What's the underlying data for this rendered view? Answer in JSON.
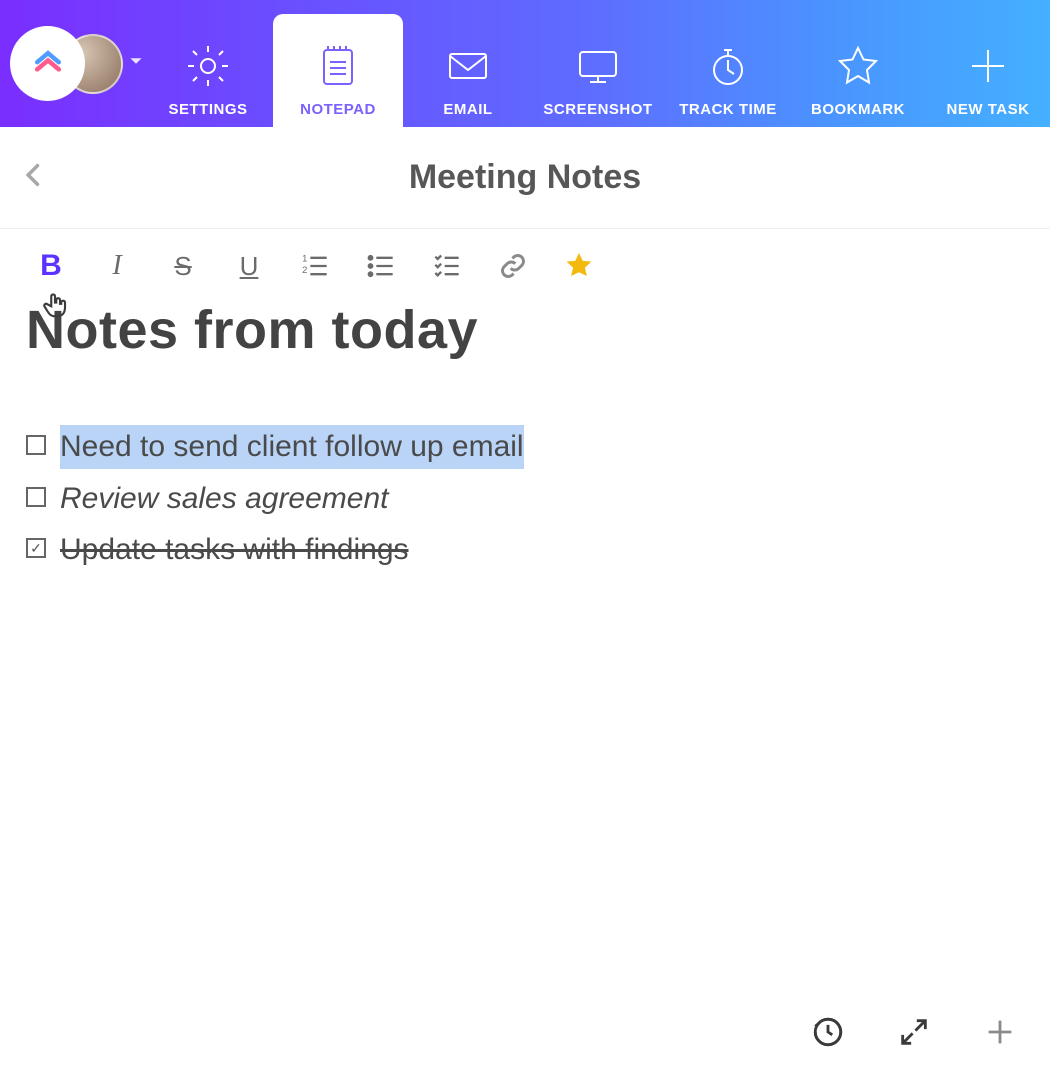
{
  "icons": {
    "logo": "clickup-logo",
    "avatar": "user-avatar",
    "dropdown": "dropdown-caret"
  },
  "tabs": [
    {
      "id": "settings",
      "label": "SETTINGS",
      "icon": "gear-icon",
      "active": false
    },
    {
      "id": "notepad",
      "label": "NOTEPAD",
      "icon": "notepad-icon",
      "active": true
    },
    {
      "id": "email",
      "label": "EMAIL",
      "icon": "envelope-icon",
      "active": false
    },
    {
      "id": "screenshot",
      "label": "SCREENSHOT",
      "icon": "monitor-icon",
      "active": false
    },
    {
      "id": "tracktime",
      "label": "TRACK TIME",
      "icon": "stopwatch-icon",
      "active": false
    },
    {
      "id": "bookmark",
      "label": "BOOKMARK",
      "icon": "star-icon",
      "active": false
    },
    {
      "id": "newtask",
      "label": "NEW TASK",
      "icon": "plus-icon",
      "active": false
    }
  ],
  "document": {
    "title": "Meeting Notes",
    "heading": "Notes from today",
    "items": [
      {
        "text": "Need to send client follow up email",
        "checked": false,
        "style": "highlight"
      },
      {
        "text": "Review sales agreement",
        "checked": false,
        "style": "italic"
      },
      {
        "text": "Update tasks with findings",
        "checked": true,
        "style": "strike"
      }
    ]
  },
  "format_toolbar": [
    {
      "id": "bold",
      "name": "bold-icon",
      "active": true
    },
    {
      "id": "italic",
      "name": "italic-icon"
    },
    {
      "id": "strikethrough",
      "name": "strikethrough-icon"
    },
    {
      "id": "underline",
      "name": "underline-icon"
    },
    {
      "id": "ordered-list",
      "name": "ordered-list-icon"
    },
    {
      "id": "unordered-list",
      "name": "unordered-list-icon"
    },
    {
      "id": "checklist",
      "name": "checklist-icon"
    },
    {
      "id": "link",
      "name": "link-icon"
    },
    {
      "id": "favorite",
      "name": "star-filled-icon"
    }
  ],
  "footer_icons": [
    {
      "id": "history",
      "name": "history-icon"
    },
    {
      "id": "expand",
      "name": "expand-icon"
    },
    {
      "id": "add",
      "name": "plus-icon"
    }
  ]
}
